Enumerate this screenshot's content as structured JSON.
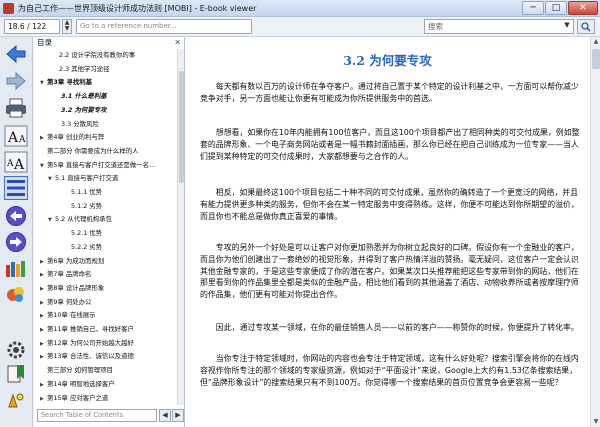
{
  "window": {
    "title": "为自己工作——世界顶级设计师成功法则 [MOBI] - E-book viewer",
    "minimize": "─",
    "maximize": "□",
    "close": "✕"
  },
  "toolbar": {
    "position": "18.6 / 122",
    "reference_placeholder": "Go to a reference number...",
    "search_placeholder": "搜索"
  },
  "icons": {
    "back": "back-arrow-icon",
    "forward": "forward-arrow-icon",
    "print": "printer-icon",
    "font_larger": "font-larger-icon",
    "font_smaller": "font-smaller-icon",
    "toc": "table-of-contents-icon",
    "prev_page": "previous-page-icon",
    "next_page": "next-page-icon",
    "library": "library-icon",
    "preferences": "preferences-icon",
    "settings": "gear-icon",
    "bookmark": "bookmark-icon",
    "fullscreen": "fullscreen-icon",
    "colors": {
      "accent": "#2a66c4",
      "nav": "#5b4fc7"
    }
  },
  "toc": {
    "header": "目录",
    "close": "✕",
    "items": [
      {
        "label": "2.2 设计学院没有教你的事",
        "twisty": "",
        "style": "normal"
      },
      {
        "label": "2.3 其他学习途径",
        "twisty": "",
        "style": "normal"
      },
      {
        "label": "第3章 寻找利基",
        "twisty": "▼",
        "style": "bold"
      },
      {
        "label": "3.1 什么是利基",
        "twisty": "",
        "style": "italic"
      },
      {
        "label": "3.2 为何要专攻",
        "twisty": "",
        "style": "italic"
      },
      {
        "label": "3.3 分散风险",
        "twisty": "",
        "style": "normal"
      },
      {
        "label": "第4章 创业的利与弊",
        "twisty": "▶",
        "style": "normal"
      },
      {
        "label": "第二部分 你需要成为什么样的人",
        "twisty": "",
        "style": "normal"
      },
      {
        "label": "第5章 直接与客户打交道还是做一名…",
        "twisty": "▼",
        "style": "normal"
      },
      {
        "label": "5.1 直接与客户打交道",
        "twisty": "▼",
        "style": "normal"
      },
      {
        "label": "5.1.1 优势",
        "twisty": "",
        "style": "normal"
      },
      {
        "label": "5.1.2 劣势",
        "twisty": "",
        "style": "normal"
      },
      {
        "label": "5.2 从代理机构承包",
        "twisty": "▼",
        "style": "normal"
      },
      {
        "label": "5.2.1 优势",
        "twisty": "",
        "style": "normal"
      },
      {
        "label": "5.2.2 劣势",
        "twisty": "",
        "style": "normal"
      },
      {
        "label": "第6章 为成功而规划",
        "twisty": "▶",
        "style": "normal"
      },
      {
        "label": "第7章 品牌命名",
        "twisty": "▶",
        "style": "normal"
      },
      {
        "label": "第8章 设计品牌形象",
        "twisty": "▶",
        "style": "normal"
      },
      {
        "label": "第9章 何处办公",
        "twisty": "▶",
        "style": "normal"
      },
      {
        "label": "第10章 在线展示",
        "twisty": "▶",
        "style": "normal"
      },
      {
        "label": "第11章 推销自己，寻找好客户",
        "twisty": "▶",
        "style": "normal"
      },
      {
        "label": "第12章 为何公司开始越大越好",
        "twisty": "▶",
        "style": "normal"
      },
      {
        "label": "第13章 合法性、诚信以及道德",
        "twisty": "▶",
        "style": "normal"
      },
      {
        "label": "第三部分 如何管理项目",
        "twisty": "",
        "style": "normal"
      },
      {
        "label": "第14章 明智地选择客户",
        "twisty": "▶",
        "style": "normal"
      },
      {
        "label": "第15章 应对客户之道",
        "twisty": "▶",
        "style": "normal"
      }
    ],
    "search_placeholder": "Search Table of Contents",
    "prev": "◀",
    "next": "▶"
  },
  "content": {
    "title": "3.2 为何要专攻",
    "paragraphs": [
      "每天都有数以百万的设计师在争夺客户。通过将自己置于某个特定的设计利基之中，一方面可以帮你减少竞争对手，另一方面也能让你更有可能成为你所提供服务中的首选。",
      "想想看，如果你在10年内能拥有100位客户，而且这100个项目都产出了相同种类的可交付成果，例如整套的品牌形象、一个电子商务网站或者是一幅书籍封面插画，那么你已经在把自己训练成为一位专家——当人们提到某种特定的可交付成果时，大家都想要与之合作的人。",
      "相反，如果最终这100个项目包括二十种不同的可交付成果，虽然你的确转造了一个更宽泛的网络，并且有能力提供更多种类的服务，但你不会在某一特定服务中变得熟练。这样，你便不可能达到你所期望的溢价，而且你也不能总是做你真正喜爱的事情。",
      "专攻的另外一个好处是可以让客户对你更加熟悉并为你树立起良好的口碑。假设你有一个金融业的客户，而且你为他们创建出了一套绝妙的视觉形象，并得到了客户热情洋溢的赞扬。毫无疑问，这位客户一定会认识其他金融专家的，于是这些专家便成了你的潜在客户。如果某次口头推荐能把这些专家带到你的网站，他们在那里看到你的作品集里全都是类似的金融产品，相比他们看到的其他涵盖了酒店、动物收养所或者按摩理疗师的作品集，他们更有可能对你提出合作。",
      "因此，通过专攻某一领域，在你的最佳销售人员——以前的客户——称赞你的时候，你便提升了转化率。",
      "当你专注于特定领域时，你网站的内容也会专注于特定领域，这有什么好处呢？搜索引擎会将你的在线内容视作你所专注的那个领域的专家级资源，例如对于“平面设计”来说，Google上大约有1.53亿条搜索结果，但“品牌形象设计”的搜索结果只有不到100万。你觉得哪一个搜索结果的首页位置竞争会更容易一些呢？"
    ]
  },
  "scrollbar": {
    "up": "▲",
    "down": "▼"
  }
}
